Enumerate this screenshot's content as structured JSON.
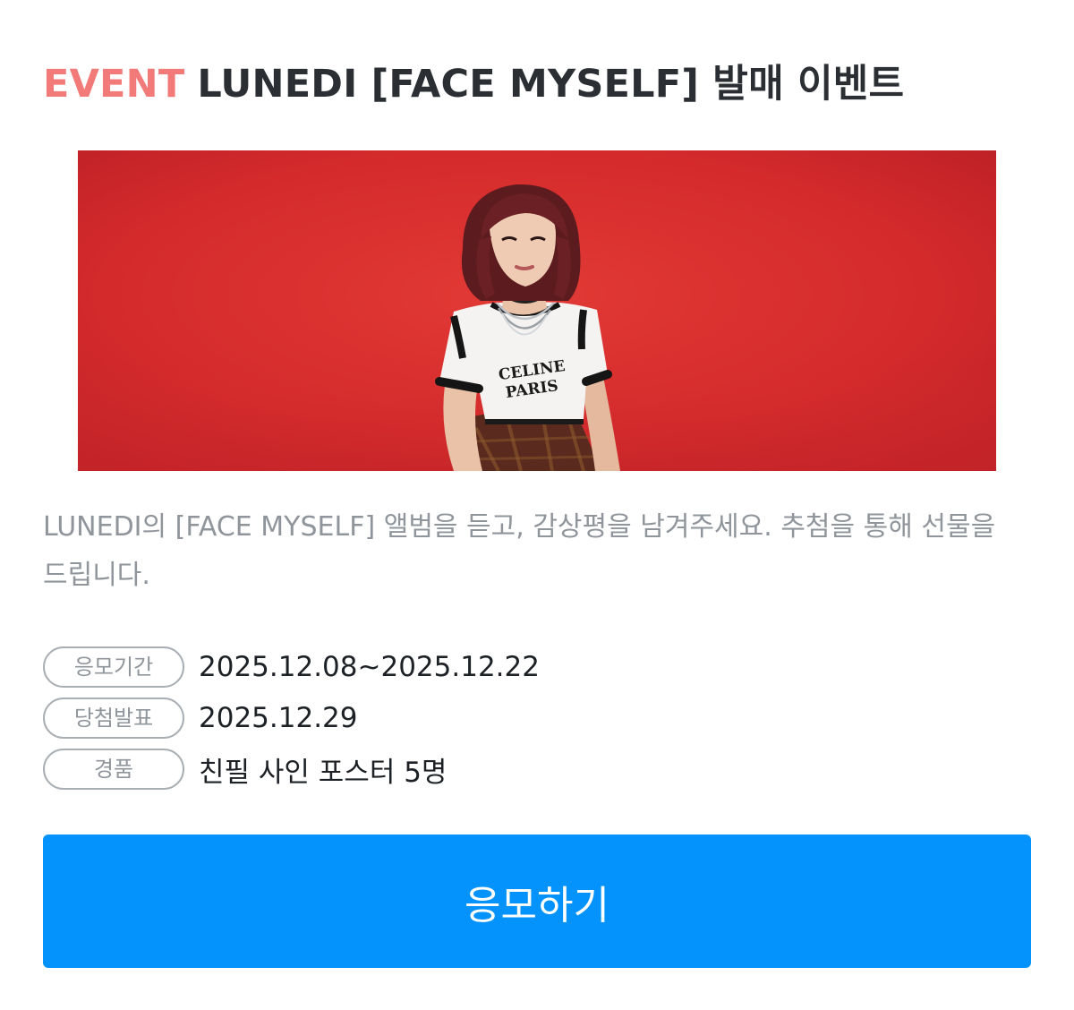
{
  "event": {
    "tag": "EVENT",
    "title": "LUNEDI [FACE MYSELF] 발매 이벤트"
  },
  "banner": {
    "shirt_text_line1": "CELINE",
    "shirt_text_line2": "PARIS",
    "background_color": "#d92b2c"
  },
  "description": "LUNEDI의 [FACE MYSELF] 앨범을 듣고, 감상평을 남겨주세요. 추첨을 통해 선물을 드립니다.",
  "info": {
    "period": {
      "label": "응모기간",
      "value": "2025.12.08~2025.12.22"
    },
    "announcement": {
      "label": "당첨발표",
      "value": "2025.12.29"
    },
    "prize": {
      "label": "경품",
      "value": "친필 사인 포스터 5명"
    }
  },
  "apply_button": {
    "label": "응모하기",
    "color": "#0493fc"
  },
  "colors": {
    "tag": "#f27a79",
    "title": "#2b2f33",
    "muted": "#8f959b",
    "value": "#1d2125"
  }
}
